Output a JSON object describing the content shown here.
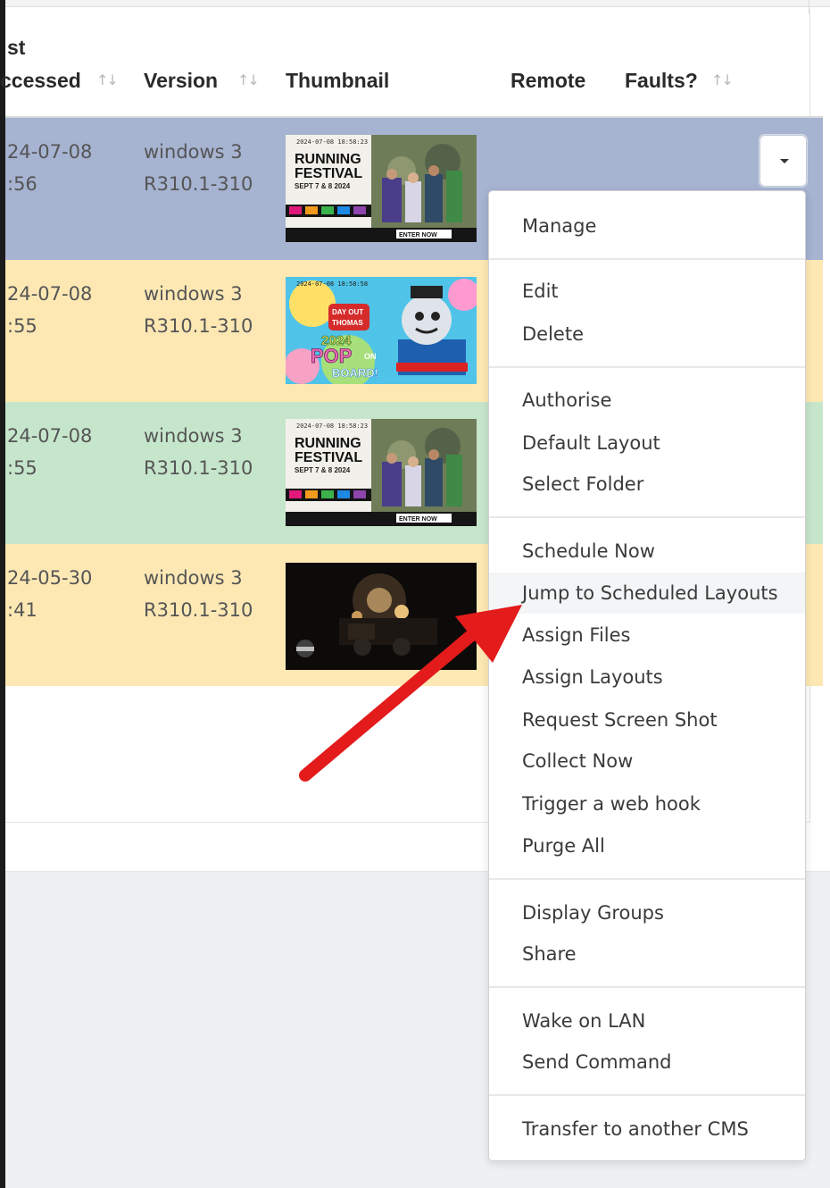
{
  "table": {
    "columns": [
      {
        "label_line1": "st",
        "label_line2": "ccessed",
        "sortable": true
      },
      {
        "label": "Version",
        "sortable": true
      },
      {
        "label": "Thumbnail",
        "sortable": false
      },
      {
        "label": "Remote",
        "sortable": false
      },
      {
        "label": "Faults?",
        "sortable": true
      }
    ],
    "sort_glyph": "↑↓",
    "rows": [
      {
        "accessed_date": "24-07-08",
        "accessed_time": ":56",
        "version_1": "windows 3",
        "version_2": "R310.1-310",
        "row_color": "#a6b3d1",
        "thumbnail": "running-festival"
      },
      {
        "accessed_date": "24-07-08",
        "accessed_time": ":55",
        "version_1": "windows 3",
        "version_2": "R310.1-310",
        "row_color": "#fde8b4",
        "thumbnail": "day-out-thomas"
      },
      {
        "accessed_date": "24-07-08",
        "accessed_time": ":55",
        "version_1": "windows 3",
        "version_2": "R310.1-310",
        "row_color": "#c6e6cc",
        "thumbnail": "running-festival"
      },
      {
        "accessed_date": "24-05-30",
        "accessed_time": ":41",
        "version_1": "windows 3",
        "version_2": "R310.1-310",
        "row_color": "#fde8b4",
        "thumbnail": "night-train"
      }
    ]
  },
  "thumbs": {
    "running": {
      "stamp": "2024-07-08 18:58:23",
      "line1": "RUNNING",
      "line2": "FESTIVAL",
      "line3": "SEPT 7 & 8 2024",
      "cta": "ENTER NOW"
    },
    "thomas": {
      "stamp": "2024-07-08 18:58:58",
      "badge1": "DAY OUT",
      "badge2": "THOMAS",
      "year": "2024",
      "pop": "POP",
      "on": "ON",
      "board": "BOARD!"
    }
  },
  "dropdown": {
    "items": {
      "manage": "Manage",
      "edit": "Edit",
      "delete": "Delete",
      "authorise": "Authorise",
      "default_layout": "Default Layout",
      "select_folder": "Select Folder",
      "schedule_now": "Schedule Now",
      "jump_to_scheduled_layouts": "Jump to Scheduled Layouts",
      "assign_files": "Assign Files",
      "assign_layouts": "Assign Layouts",
      "request_screen_shot": "Request Screen Shot",
      "collect_now": "Collect Now",
      "trigger_web_hook": "Trigger a web hook",
      "purge_all": "Purge All",
      "display_groups": "Display Groups",
      "share": "Share",
      "wake_on_lan": "Wake on LAN",
      "send_command": "Send Command",
      "transfer_cms": "Transfer to another CMS"
    }
  },
  "colors": {
    "annotation_arrow": "#e31b1b",
    "highlight_row": "#a6b3d1",
    "menu_hover": "#f3f5f7"
  }
}
